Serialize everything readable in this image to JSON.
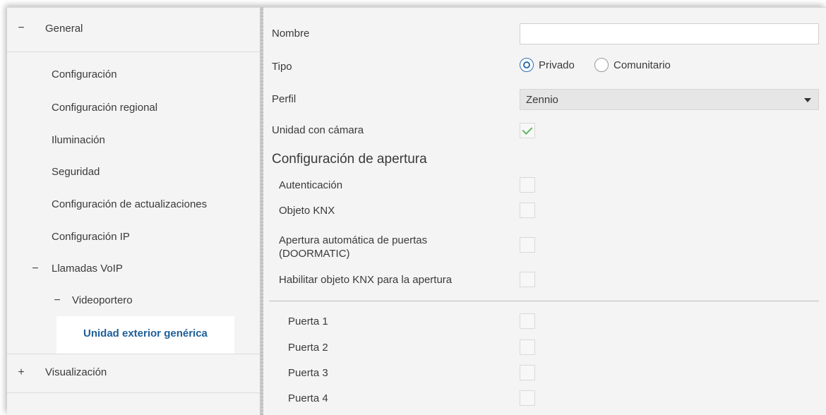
{
  "sidebar": {
    "general": {
      "sign": "−",
      "label": "General"
    },
    "items": [
      {
        "label": "Configuración"
      },
      {
        "label": "Configuración regional"
      },
      {
        "label": "Iluminación"
      },
      {
        "label": "Seguridad"
      },
      {
        "label": "Configuración de actualizaciones"
      },
      {
        "label": "Configuración IP"
      }
    ],
    "voip": {
      "sign": "−",
      "label": "Llamadas VoIP"
    },
    "videoportero": {
      "sign": "−",
      "label": "Videoportero"
    },
    "selected": {
      "label": "Unidad exterior genérica"
    },
    "visualizacion": {
      "sign": "+",
      "label": "Visualización"
    }
  },
  "form": {
    "nombre": {
      "label": "Nombre",
      "value": ""
    },
    "tipo": {
      "label": "Tipo",
      "options": [
        "Privado",
        "Comunitario"
      ],
      "selected": "Privado"
    },
    "perfil": {
      "label": "Perfil",
      "value": "Zennio"
    },
    "camara": {
      "label": "Unidad con cámara",
      "checked": true
    },
    "section_title": "Configuración de apertura",
    "autenticacion": {
      "label": "Autenticación",
      "checked": false
    },
    "objeto_knx": {
      "label": "Objeto KNX",
      "checked": false
    },
    "doormatic": {
      "label_line1": "Apertura automática de puertas",
      "label_line2": "(DOORMATIC)",
      "checked": false
    },
    "habilitar": {
      "label": "Habilitar objeto KNX para la apertura",
      "checked": false
    },
    "puertas": [
      {
        "label": "Puerta 1",
        "checked": false
      },
      {
        "label": "Puerta 2",
        "checked": false
      },
      {
        "label": "Puerta 3",
        "checked": false
      },
      {
        "label": "Puerta 4",
        "checked": false
      }
    ]
  },
  "colors": {
    "accent": "#1f5f9a",
    "check": "#5cb85c",
    "radio": "#2f6fb0"
  }
}
